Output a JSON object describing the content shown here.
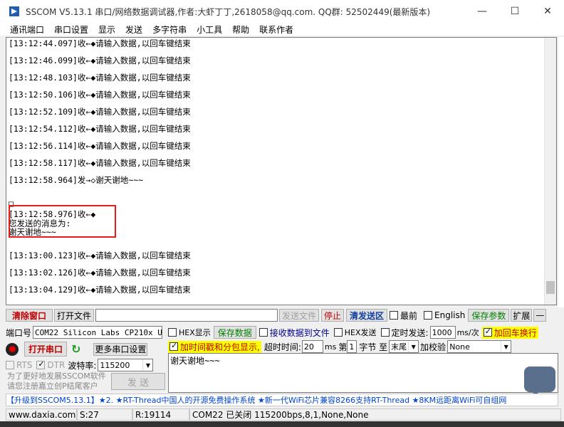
{
  "window": {
    "title": "SSCOM V5.13.1 串口/网络数据调试器,作者:大虾丁丁,2618058@qq.com. QQ群: 52502449(最新版本)",
    "minimize_glyph": "—",
    "maximize_glyph": "☐",
    "close_glyph": "✕"
  },
  "menu": [
    "通讯端口",
    "串口设置",
    "显示",
    "发送",
    "多字符串",
    "小工具",
    "帮助",
    "联系作者"
  ],
  "receive": {
    "lines": [
      "[13:12:44.097]收←◆请输入数据,以回车键结束",
      "[13:12:46.099]收←◆请输入数据,以回车键结束",
      "[13:12:48.103]收←◆请输入数据,以回车键结束",
      "[13:12:50.106]收←◆请输入数据,以回车键结束",
      "[13:12:52.109]收←◆请输入数据,以回车键结束",
      "[13:12:54.112]收←◆请输入数据,以回车键结束",
      "[13:12:56.114]收←◆请输入数据,以回车键结束",
      "[13:12:58.117]收←◆请输入数据,以回车键结束",
      "[13:12:58.964]发→◇谢天谢地~~~",
      "□",
      "[13:12:58.976]收←◆",
      "您发送的消息为:",
      "谢天谢地~~~",
      "[13:13:00.123]收←◆请输入数据,以回车键结束",
      "[13:13:02.126]收←◆请输入数据,以回车键结束",
      "[13:13:04.129]收←◆请输入数据,以回车键结束"
    ]
  },
  "toolbar1": {
    "clear": "清除窗口",
    "open_file": "打开文件",
    "send_file": "发送文件",
    "stop": "停止",
    "clear_send": "清发送区",
    "topmost": "最前",
    "english": "English",
    "save_params": "保存参数",
    "expand": "扩展",
    "collapse": "—"
  },
  "port": {
    "port_label": "端口号",
    "port_value": "COM22 Silicon Labs CP210x U",
    "open_port": "打开串口",
    "more_settings": "更多串口设置",
    "rts": "RTS",
    "dtr": "DTR",
    "baud_label": "波特率:",
    "baud_value": "115200",
    "promo_line1": "为了更好地发展SSCOM软件",
    "promo_line2": "请您注册嘉立创P结尾客户",
    "send_button": "发  送"
  },
  "options": {
    "hex_display": "HEX显示",
    "save_data": "保存数据",
    "recv_to_file": "接收数据到文件",
    "hex_send": "HEX发送",
    "timed_send": "定时发送:",
    "timed_value": "1000",
    "timed_unit": "ms/次",
    "add_crlf": "加回车换行",
    "add_timestamp": "加时间戳和分包显示,",
    "timeout_label": "超时时间:",
    "timeout_value": "20",
    "timeout_unit": "ms",
    "byte_prefix": "第",
    "byte_value": "1",
    "byte_unit": "字节 至",
    "end_value": "末尾",
    "checksum_label": "加校验",
    "checksum_value": "None"
  },
  "send_area": {
    "text": "谢天谢地~~~"
  },
  "adbar": {
    "text": "【升级到SSCOM5.13.1】★2. ★RT-Thread中国人的开源免费操作系统 ★新一代WiFi芯片兼容8266支持RT-Thread ★8KM远距离WiFi可自组网"
  },
  "status": {
    "website": "www.daxia.com",
    "sent": "S:27",
    "received": "R:19114",
    "port_state": "COM22 已关闭  115200bps,8,1,None,None"
  }
}
